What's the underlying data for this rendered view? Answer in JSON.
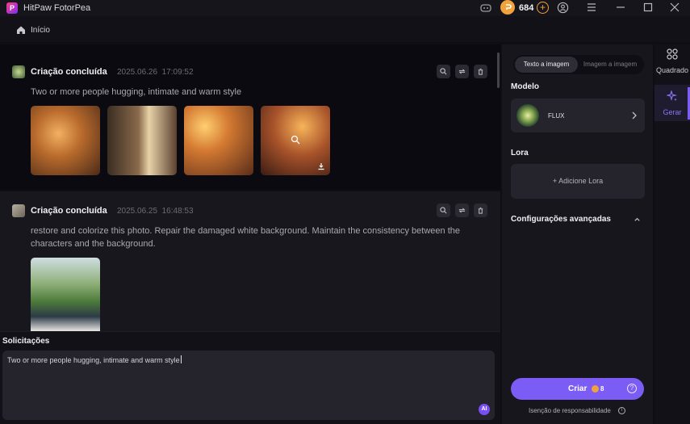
{
  "titlebar": {
    "app_title": "HitPaw FotorPea",
    "coin_count": "684",
    "plus_symbol": "+"
  },
  "breadcrumb": {
    "home_label": "Início"
  },
  "feed": {
    "cards": [
      {
        "title": "Criação concluída",
        "date": "2025.06.26",
        "time": "17:09:52",
        "prompt": "Two or more people hugging, intimate and warm style",
        "image_count": 4
      },
      {
        "title": "Criação concluída",
        "date": "2025.06.25",
        "time": "16:48:53",
        "prompt": "restore and colorize this photo. Repair the damaged white background. Maintain the consistency between the characters and the background.",
        "image_count": 1
      }
    ]
  },
  "prompt_panel": {
    "label": "Solicitações",
    "value": "Two or more people hugging, intimate and warm style",
    "ai_badge": "AI"
  },
  "settings": {
    "mode_tabs": [
      "Texto a imagem",
      "Imagem a imagem"
    ],
    "active_mode": "Texto a imagem",
    "model_section": "Modelo",
    "model_name": "FLUX",
    "lora_section": "Lora",
    "lora_button": "+ Adicione Lora",
    "advanced_section": "Configurações avançadas",
    "create_button": "Criar",
    "create_cost": "8",
    "help_symbol": "?",
    "info_symbol": "i",
    "disclaimer": "Isenção de responsabilidade"
  },
  "side_nav": [
    {
      "label": "Quadrado",
      "icon": "grid-icon",
      "active": false
    },
    {
      "label": "Gerar",
      "icon": "sparkle-icon",
      "active": true
    }
  ],
  "colors": {
    "accent": "#7b5cf5",
    "coin": "#f2a23c",
    "background": "#0f0e14",
    "panel": "#17161d"
  }
}
